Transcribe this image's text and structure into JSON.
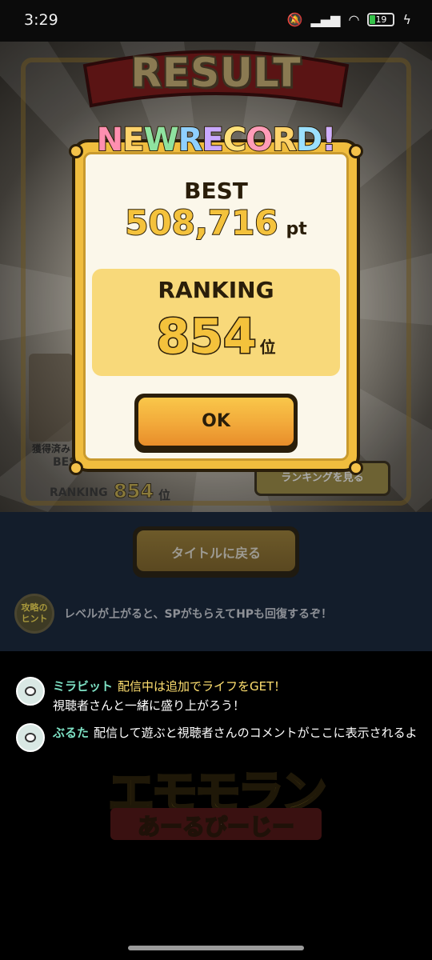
{
  "status_bar": {
    "time": "3:29",
    "battery_level": "19"
  },
  "background": {
    "result_title": "RESULT",
    "best_label_partial": "BES",
    "owned_label": "獲得済み",
    "ranking_label": "RANKING",
    "ranking_value": "854",
    "ranking_unit": "位",
    "ranking_button": "ランキングを見る"
  },
  "modal": {
    "banner": "NEWRECORD!",
    "banner_colors": [
      "#ff8fb0",
      "#ffd36b",
      "#8fe3a0",
      "#8fd0ff",
      "#c9a8ff",
      "#ffe17a",
      "#ff9cb8",
      "#ffd36b",
      "#9be0ff",
      "#d0b0ff"
    ],
    "best_label": "BEST",
    "best_score": "508,716",
    "best_unit": "pt",
    "ranking_label": "RANKING",
    "ranking_value": "854",
    "ranking_unit": "位",
    "ok_label": "OK"
  },
  "panel": {
    "title_button": "タイトルに戻る",
    "hint_badge": "攻略の ヒント",
    "hint_text": "レベルが上がると、SPがもらえてHPも回復するぞ！"
  },
  "comments": [
    {
      "name": "ミラビット",
      "highlight": "配信中は追加でライフをGET！",
      "message": "視聴者さんと一緒に盛り上がろう！"
    },
    {
      "name": "ぶるた",
      "highlight": "",
      "message": "配信して遊ぶと視聴者さんのコメントがここに表示されるよ"
    }
  ],
  "logo": {
    "line1": "エモモラン",
    "line2": "あーるぴーじー"
  },
  "colors": {
    "gold": "#f4c23c",
    "navy": "#131d2b",
    "comment_name": "#7fe3c6",
    "comment_highlight": "#ffe070"
  }
}
